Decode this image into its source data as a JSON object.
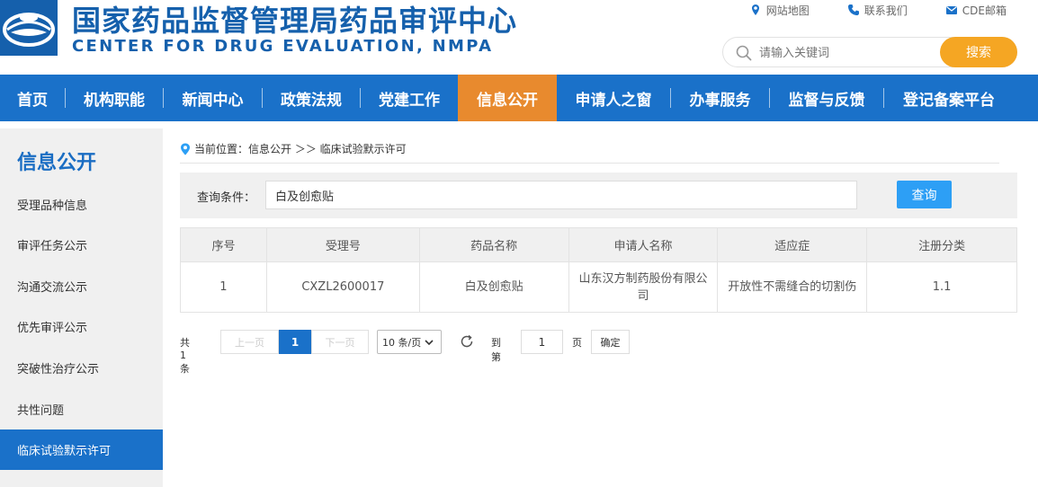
{
  "header": {
    "title_cn": "国家药品监督管理局药品审评中心",
    "title_en": "CENTER FOR DRUG EVALUATION, NMPA",
    "links": [
      {
        "label": "网站地图",
        "icon": "map-pin-icon"
      },
      {
        "label": "联系我们",
        "icon": "phone-icon"
      },
      {
        "label": "CDE邮箱",
        "icon": "mail-icon"
      }
    ],
    "search": {
      "placeholder": "请输入关键词",
      "button": "搜索"
    }
  },
  "nav": {
    "items": [
      {
        "label": "首页"
      },
      {
        "label": "机构职能"
      },
      {
        "label": "新闻中心"
      },
      {
        "label": "政策法规"
      },
      {
        "label": "党建工作"
      },
      {
        "label": "信息公开",
        "active": true
      },
      {
        "label": "申请人之窗"
      },
      {
        "label": "办事服务"
      },
      {
        "label": "监督与反馈"
      },
      {
        "label": "登记备案平台"
      }
    ]
  },
  "sidebar": {
    "title": "信息公开",
    "items": [
      {
        "label": "受理品种信息"
      },
      {
        "label": "审评任务公示"
      },
      {
        "label": "沟通交流公示"
      },
      {
        "label": "优先审评公示"
      },
      {
        "label": "突破性治疗公示"
      },
      {
        "label": "共性问题"
      },
      {
        "label": "临床试验默示许可",
        "active": true
      }
    ]
  },
  "breadcrumb": {
    "text": "当前位置：信息公开 ＞＞ 临床试验默示许可"
  },
  "query": {
    "label": "查询条件：",
    "value": "白及创愈贴",
    "button": "查询"
  },
  "table": {
    "headers": [
      "序号",
      "受理号",
      "药品名称",
      "申请人名称",
      "适应症",
      "注册分类"
    ],
    "rows": [
      [
        "1",
        "CXZL2600017",
        "白及创愈贴",
        "山东汉方制药股份有限公司",
        "开放性不需缝合的切割伤",
        "1.1"
      ]
    ]
  },
  "pager": {
    "total": "共 1 条",
    "prev": "上一页",
    "current": "1",
    "next": "下一页",
    "page_size": "10 条/页",
    "jump_prefix": "到第",
    "jump_value": "1",
    "jump_suffix": "页",
    "confirm": "确定"
  },
  "colors": {
    "brand_blue": "#1a71c9",
    "active_orange": "#e88a2e",
    "search_button": "#f5a623",
    "query_button": "#2d9ff5"
  }
}
